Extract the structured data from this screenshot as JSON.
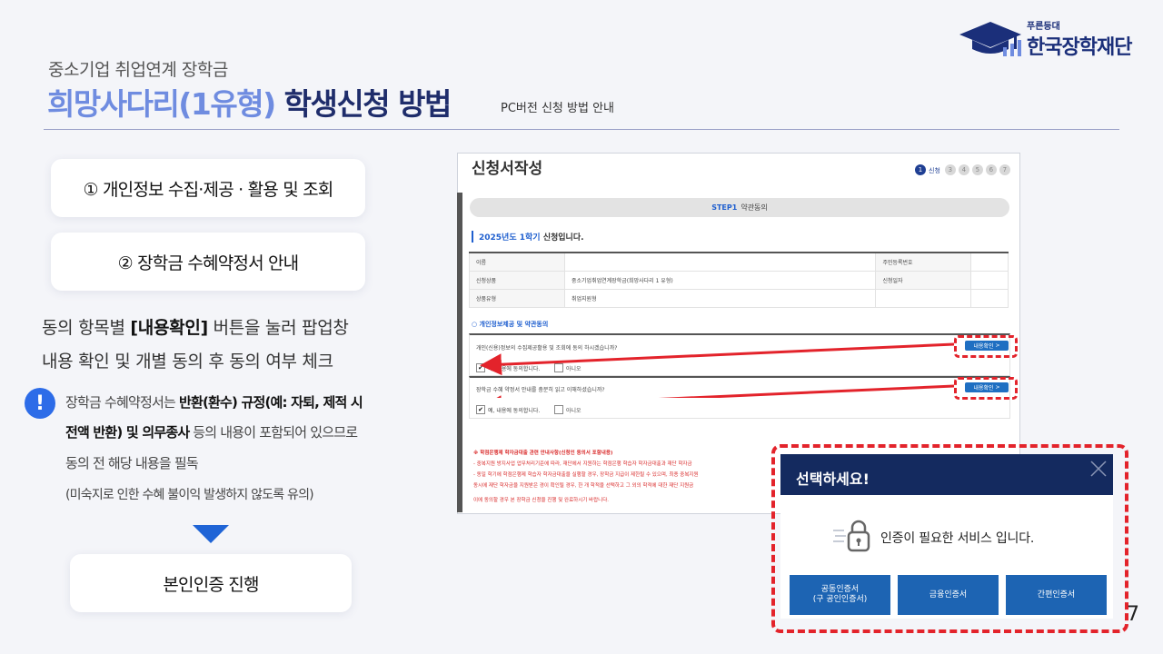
{
  "header": {
    "subtitle": "중소기업 취업연계 장학금",
    "title_part1": "희망사다리(1유형)",
    "title_part2": "학생신청 방법",
    "title_note": "PC버전 신청 방법 안내"
  },
  "logo": {
    "small": "푸른등대",
    "main": "한국장학재단",
    "icon": "graduation-cap-icon"
  },
  "steps_left": {
    "card1": "① 개인정보 수집·제공 · 활용 및 조회",
    "card2": "② 장학금 수혜약정서 안내",
    "desc_line1_a": "동의 항목별 ",
    "desc_line1_b": "[내용확인]",
    "desc_line1_c": " 버튼을 눌러 팝업창",
    "desc_line2": "내용 확인 및 개별 동의 후 동의 여부 체크",
    "note_line1_a": "장학금 수혜약정서는 ",
    "note_line1_b": "반환(환수) 규정(예: 자퇴, 제적 시",
    "note_line2_a": "전액 반환) 및 의무종사",
    "note_line2_b": " 등의 내용이 포함되어 있으므로",
    "note_line3": "동의 전 해당 내용을 필독",
    "note_line4": "(미숙지로 인한 수혜 불이익 발생하지 않도록 유의)",
    "card3": "본인인증 진행"
  },
  "screenshot": {
    "title": "신청서작성",
    "steps": [
      "1",
      "3",
      "4",
      "5",
      "6",
      "7"
    ],
    "step_active_label": "신청",
    "stepbar_step": "STEP1",
    "stepbar_label": "약관동의",
    "semester_a": "2025년도 1학기",
    "semester_b": " 신청입니다.",
    "table": [
      [
        "이름",
        "",
        "주민등록번호",
        ""
      ],
      [
        "신청상품",
        "중소기업취업연계장학금(희망사다리 1 유형)",
        "신청일자",
        ""
      ],
      [
        "상품유형",
        "취업지원형",
        "",
        ""
      ]
    ],
    "agree_head": "개인정보제공 및 약관동의",
    "q1": "개인(신용)정보의 수집제공활용 및 조회에 동의 하시겠습니까?",
    "q2": "장학금 수혜 약정서 안내를 충분히 읽고 이해하셨습니까?",
    "yes": "예, 내용에 동의합니다.",
    "no": "아니오",
    "confirm_btn": "내용확인",
    "notice": [
      "※ 학점은행제 학자금대출 관련 안내사항(신청인 동의서 포함내용)",
      "- 중복지원 방지사업 업무처리기준에 따라, 재단에서 지원하는 학점은행 학습자 학자금대출과 재단 학자금",
      "- 동일 학기에 학점은행제 학습자 학자금대출을 실행할 경우, 장학금 지급이 제한될 수 있으며, 최종 중복지원",
      "동시에 재단 학자금을 지원받은 경이 확인될 경우, 한 개 학적을 선택하고 그 외의 학적에 대한 재단 지원금",
      "이에 동의할 경우 본 장학금 신청을 진행 및 완료하시기 바랍니다."
    ]
  },
  "popup": {
    "title": "선택하세요!",
    "message": "인증이 필요한 서비스 입니다.",
    "btn1_line1": "공동인증서",
    "btn1_line2": "(구 공인인증서)",
    "btn2": "금융인증서",
    "btn3": "간편인증서"
  },
  "page_number": "7",
  "colors": {
    "navy": "#1f2d6b",
    "light_blue": "#6f8ce0",
    "accent_red": "#e3232b",
    "button_blue": "#1d64b3"
  }
}
